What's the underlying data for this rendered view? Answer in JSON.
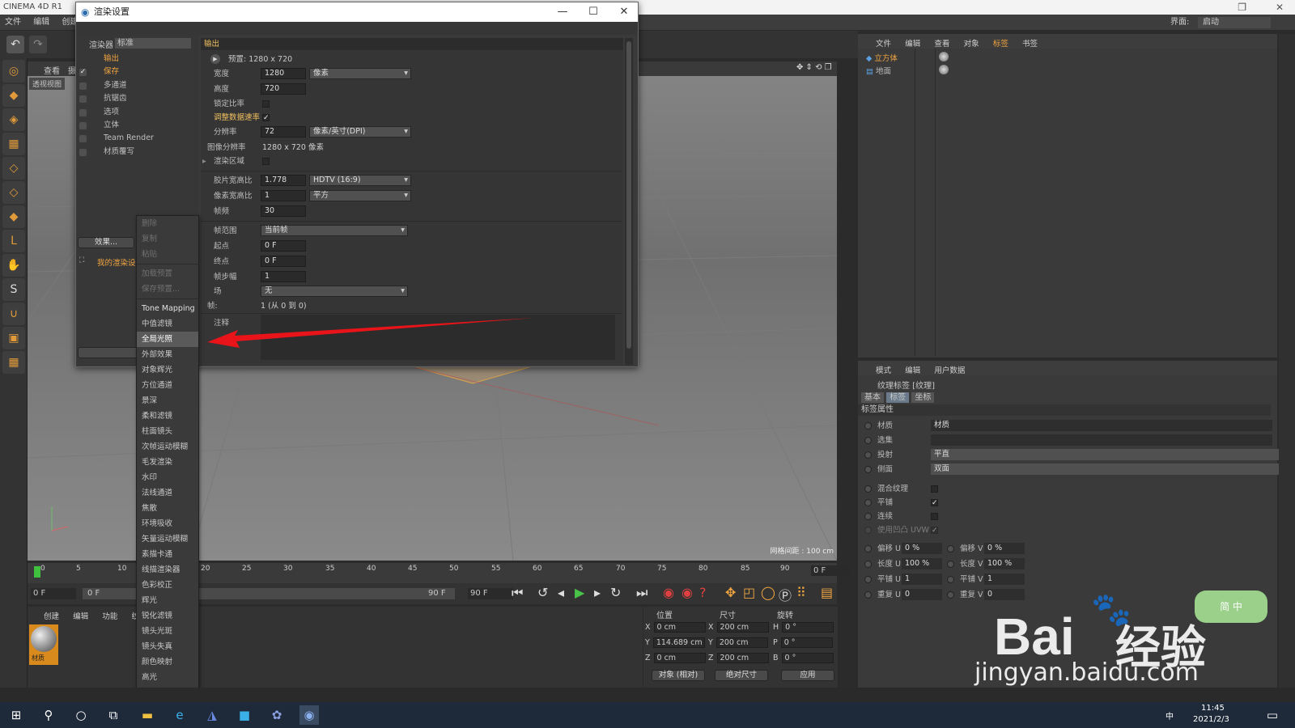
{
  "app": {
    "window_title": "CINEMA 4D R1",
    "interface_label": "界面:",
    "interface_value": "启动"
  },
  "menubar": [
    "文件",
    "编辑",
    "创建"
  ],
  "dialog": {
    "title": "渲染设置",
    "renderer_label": "渲染器",
    "renderer_value": "标准",
    "nav": [
      {
        "label": "输出",
        "checked": false,
        "active": true
      },
      {
        "label": "保存",
        "checked": true,
        "active": true
      },
      {
        "label": "多通道",
        "checked": false,
        "active": false
      },
      {
        "label": "抗锯齿",
        "checked": false,
        "active": false
      },
      {
        "label": "选项",
        "checked": false,
        "active": false
      },
      {
        "label": "立体",
        "checked": false,
        "active": false
      },
      {
        "label": "Team Render",
        "checked": false,
        "active": false
      },
      {
        "label": "材质覆写",
        "checked": false,
        "active": false
      }
    ],
    "effects_button": "效果...",
    "my_render": "我的渲染设",
    "render_button": "渲染",
    "section": "输出",
    "preset": "预置: 1280 x 720",
    "width_label": "宽度",
    "width_value": "1280",
    "width_unit": "像素",
    "height_label": "高度",
    "height_value": "720",
    "lock_ratio_label": "锁定比率",
    "adapt_rate_label": "调整数据速率",
    "resolution_label": "分辨率",
    "resolution_value": "72",
    "resolution_unit": "像素/英寸(DPI)",
    "image_res_label": "图像分辨率",
    "image_res_value": "1280 x 720 像素",
    "render_region_label": "渲染区域",
    "film_aspect_label": "胶片宽高比",
    "film_aspect_value": "1.778",
    "film_aspect_preset": "HDTV (16:9)",
    "pixel_aspect_label": "像素宽高比",
    "pixel_aspect_value": "1",
    "pixel_aspect_preset": "平方",
    "fps_label": "帧频",
    "fps_value": "30",
    "frame_range_label": "帧范围",
    "frame_range_value": "当前帧",
    "start_label": "起点",
    "start_value": "0 F",
    "end_label": "终点",
    "end_value": "0 F",
    "step_label": "帧步幅",
    "step_value": "1",
    "field_label": "场",
    "field_value": "无",
    "frames_label": "帧:",
    "frames_value": "1 (从 0 到 0)",
    "notes_label": "注释"
  },
  "context_menu": {
    "items_disabled": [
      "删除",
      "复制",
      "粘贴",
      "加载预置",
      "保存预置..."
    ],
    "items": [
      "Tone Mapping",
      "中值滤镜",
      "全局光照",
      "外部效果",
      "对象辉光",
      "方位通道",
      "景深",
      "柔和滤镜",
      "柱面镜头",
      "次帧运动模糊",
      "毛发渲染",
      "水印",
      "法线通道",
      "焦散",
      "环境吸收",
      "矢量运动模糊",
      "素描卡通",
      "线描渲染器",
      "色彩校正",
      "辉光",
      "锐化滤镜",
      "镜头光斑",
      "镜头失真",
      "颜色映射",
      "高光"
    ],
    "selected": "全局光照"
  },
  "viewport": {
    "menu": [
      "查看",
      "摄"
    ],
    "label": "透视视图",
    "grid_info": "网格间距 : 100 cm"
  },
  "timeline": {
    "ticks": [
      "0",
      "5",
      "10",
      "15",
      "20",
      "25",
      "30",
      "35",
      "40",
      "45",
      "50",
      "55",
      "60",
      "65",
      "70",
      "75",
      "80",
      "85",
      "90"
    ],
    "current": "0 F",
    "start": "0 F",
    "end_field": "90 F",
    "end_field2": "90 F",
    "slider_label": "0 F"
  },
  "material_manager": {
    "menu": [
      "创建",
      "编辑",
      "功能",
      "纹理"
    ],
    "material_name": "材质"
  },
  "coords": {
    "headers": [
      "位置",
      "尺寸",
      "旋转"
    ],
    "rows": [
      {
        "axis": "X",
        "pos": "0 cm",
        "saxis": "X",
        "size": "200 cm",
        "raxis": "H",
        "rot": "0 °"
      },
      {
        "axis": "Y",
        "pos": "114.689 cm",
        "saxis": "Y",
        "size": "200 cm",
        "raxis": "P",
        "rot": "0 °"
      },
      {
        "axis": "Z",
        "pos": "0 cm",
        "saxis": "Z",
        "size": "200 cm",
        "raxis": "B",
        "rot": "0 °"
      }
    ],
    "mode1": "对象 (相对)",
    "mode2": "绝对尺寸",
    "apply": "应用"
  },
  "object_manager": {
    "menu": [
      "文件",
      "编辑",
      "查看",
      "对象",
      "标签",
      "书签"
    ],
    "objects": [
      "立方体",
      "地面"
    ]
  },
  "attribute_manager": {
    "menu": [
      "模式",
      "编辑",
      "用户数据"
    ],
    "title": "纹理标签 [纹理]",
    "tabs": [
      "基本",
      "标签",
      "坐标"
    ],
    "section": "标签属性",
    "material_label": "材质",
    "material_value": "材质",
    "selection_label": "选集",
    "projection_label": "投射",
    "projection_value": "平直",
    "side_label": "侧面",
    "side_value": "双面",
    "mix_label": "混合纹理",
    "tile_label": "平铺",
    "seamless_label": "连续",
    "uvw_label": "使用凹凸 UVW",
    "offset_u_label": "偏移 U",
    "offset_u": "0 %",
    "offset_v_label": "偏移 V",
    "offset_v": "0 %",
    "length_u_label": "长度 U",
    "length_u": "100 %",
    "length_v_label": "长度 V",
    "length_v": "100 %",
    "tiles_u_label": "平铺 U",
    "tiles_u": "1",
    "tiles_v_label": "平铺 V",
    "tiles_v": "1",
    "repeat_u_label": "重复 U",
    "repeat_u": "0",
    "repeat_v_label": "重复 V",
    "repeat_v": "0"
  },
  "taskbar": {
    "time": "11:45",
    "date": "2021/2/3",
    "ime": "中"
  },
  "watermark": {
    "brand": "Bai",
    "brand2": "经验",
    "url": "jingyan.baidu.com",
    "bubble": "简 中"
  },
  "colors": {
    "accent": "#f0a440",
    "arrow": "#e8141a",
    "panel": "#3a3a3a"
  }
}
